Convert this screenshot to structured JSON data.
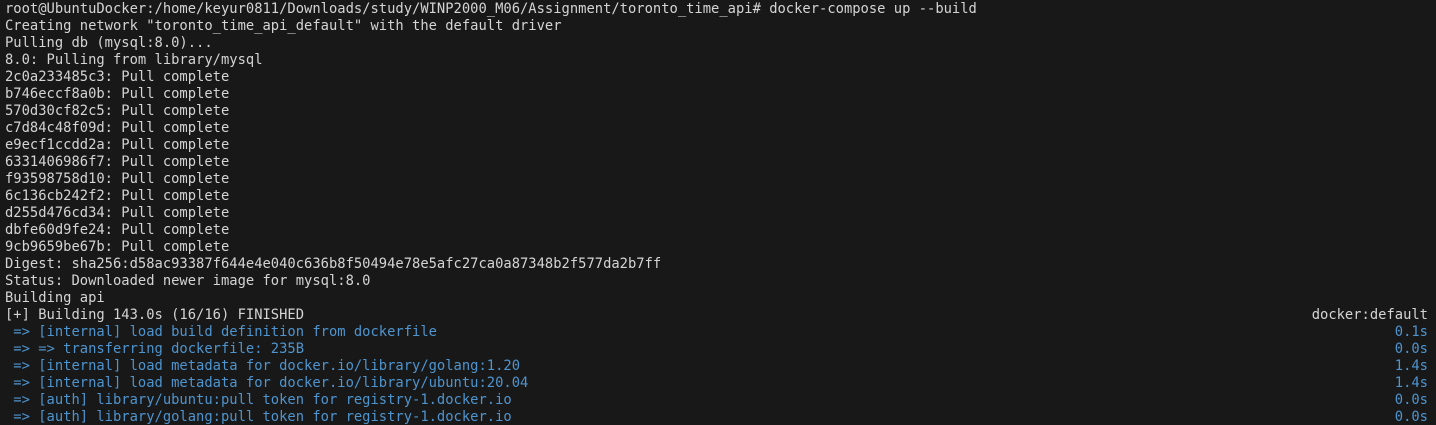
{
  "terminal": {
    "prompt_line": "root@UbuntuDocker:/home/keyur0811/Downloads/study/WINP2000_M06/Assignment/toronto_time_api# docker-compose up --build",
    "lines": [
      "Creating network \"toronto_time_api_default\" with the default driver",
      "Pulling db (mysql:8.0)...",
      "8.0: Pulling from library/mysql",
      "2c0a233485c3: Pull complete",
      "b746eccf8a0b: Pull complete",
      "570d30cf82c5: Pull complete",
      "c7d84c48f09d: Pull complete",
      "e9ecf1ccdd2a: Pull complete",
      "6331406986f7: Pull complete",
      "f93598758d10: Pull complete",
      "6c136cb242f2: Pull complete",
      "d255d476cd34: Pull complete",
      "dbfe60d9fe24: Pull complete",
      "9cb9659be67b: Pull complete",
      "Digest: sha256:d58ac93387f644e4e040c636b8f50494e78e5afc27ca0a87348b2f577da2b7ff",
      "Status: Downloaded newer image for mysql:8.0",
      "Building api"
    ],
    "build_header": {
      "text": "[+] Building 143.0s (16/16) FINISHED",
      "context": "docker:default"
    },
    "build_steps": [
      {
        "text": " => [internal] load build definition from dockerfile",
        "time": "0.1s"
      },
      {
        "text": " => => transferring dockerfile: 235B",
        "time": "0.0s"
      },
      {
        "text": " => [internal] load metadata for docker.io/library/golang:1.20",
        "time": "1.4s"
      },
      {
        "text": " => [internal] load metadata for docker.io/library/ubuntu:20.04",
        "time": "1.4s"
      },
      {
        "text": " => [auth] library/ubuntu:pull token for registry-1.docker.io",
        "time": "0.0s"
      },
      {
        "text": " => [auth] library/golang:pull token for registry-1.docker.io",
        "time": "0.0s"
      }
    ],
    "colors": {
      "background": "#181818",
      "text": "#d4d4d4",
      "build_step": "#4e94ce"
    }
  }
}
